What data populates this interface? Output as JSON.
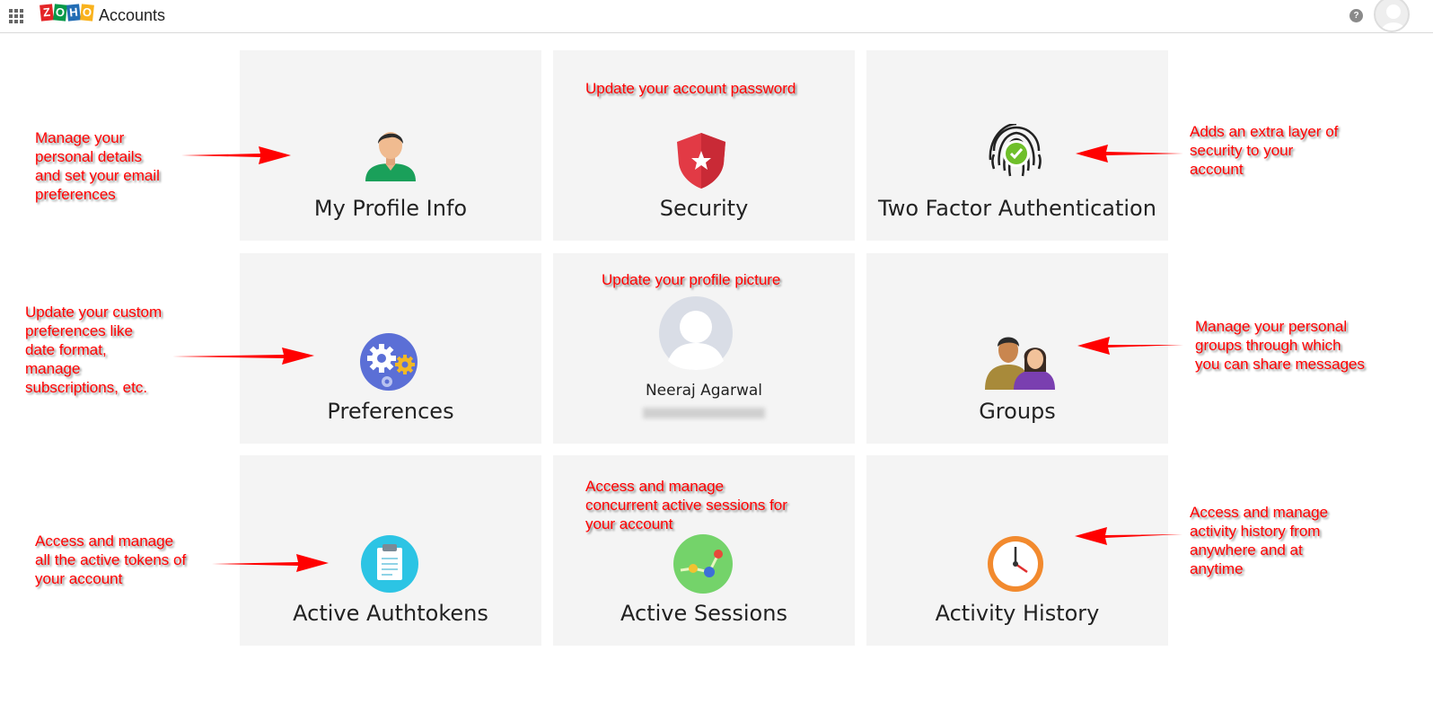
{
  "header": {
    "logo_letters": [
      "Z",
      "O",
      "H",
      "O"
    ],
    "title": "Accounts",
    "help_label": "?"
  },
  "cards": {
    "profile": {
      "label": "My Profile Info",
      "icon": "user-avatar-icon"
    },
    "security": {
      "label": "Security",
      "icon": "shield-star-icon"
    },
    "tfa": {
      "label": "Two Factor Authentication",
      "icon": "fingerprint-check-icon"
    },
    "preferences": {
      "label": "Preferences",
      "icon": "gears-icon"
    },
    "user": {
      "name": "Neeraj Agarwal",
      "icon": "profile-picture-placeholder"
    },
    "groups": {
      "label": "Groups",
      "icon": "people-group-icon"
    },
    "authtokens": {
      "label": "Active Authtokens",
      "icon": "clipboard-icon"
    },
    "sessions": {
      "label": "Active Sessions",
      "icon": "network-nodes-icon"
    },
    "history": {
      "label": "Activity History",
      "icon": "clock-icon"
    }
  },
  "annotations": {
    "profile": "Manage your\npersonal details\nand set your email\npreferences",
    "security": "Update your account password",
    "tfa": "Adds an extra layer of\nsecurity to your\naccount",
    "preferences": "Update your custom\npreferences like\ndate format,\nmanage\nsubscriptions, etc.",
    "picture": "Update your profile picture",
    "groups": "Manage your personal\ngroups through which\nyou can share messages",
    "authtokens": "Access and manage\nall the active tokens of\nyour account",
    "sessions": "Access and manage\nconcurrent active sessions for\nyour account",
    "history": "Access and manage\nactivity history from\nanywhere and at\nanytime"
  },
  "colors": {
    "annotation": "#ff0000",
    "card_bg": "#f4f4f4",
    "brand_red": "#e42527",
    "brand_green": "#089949",
    "brand_blue": "#226db4",
    "brand_yellow": "#f9b21d"
  }
}
